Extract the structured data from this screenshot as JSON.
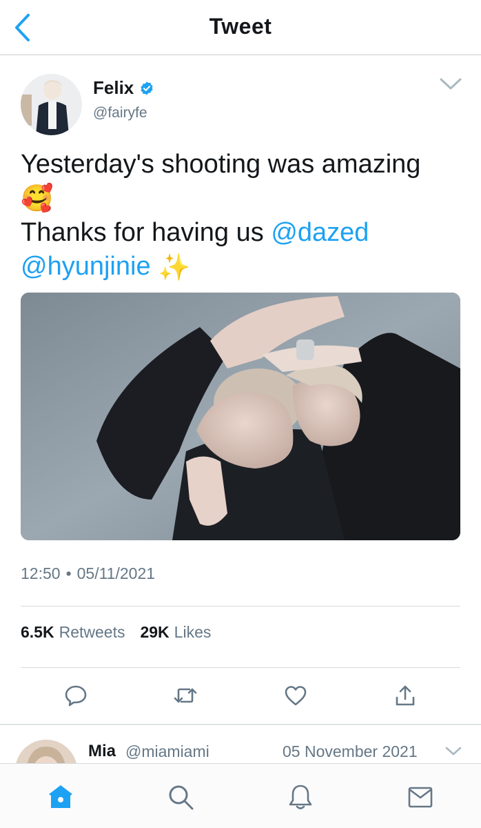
{
  "header": {
    "title": "Tweet"
  },
  "author": {
    "name": "Felix",
    "handle": "@fairyfe",
    "verified": true
  },
  "tweet": {
    "text_line1": "Yesterday's shooting was amazing",
    "emoji1": "🥰",
    "text_line3_prefix": "Thanks for having us",
    "mention1": "@dazed",
    "mention2": "@hyunjinie",
    "emoji2": "✨"
  },
  "meta": {
    "time": "12:50",
    "separator": "•",
    "date": "05/11/2021"
  },
  "stats": {
    "retweets_count": "6.5K",
    "retweets_label": "Retweets",
    "likes_count": "29K",
    "likes_label": "Likes"
  },
  "reply": {
    "name": "Mia",
    "handle": "@miamiami",
    "date": "05 November 2021"
  },
  "icons": {
    "back": "chevron-left-icon",
    "verified": "verified-badge-icon",
    "more": "chevron-down-icon",
    "reply": "speech-bubble-icon",
    "retweet": "retweet-icon",
    "like": "heart-icon",
    "share": "share-icon",
    "home": "home-icon",
    "search": "search-icon",
    "notifications": "bell-icon",
    "messages": "mail-icon"
  },
  "colors": {
    "accent": "#1da1f2",
    "text": "#14171a",
    "muted": "#657786",
    "divider": "#d6dadd"
  }
}
